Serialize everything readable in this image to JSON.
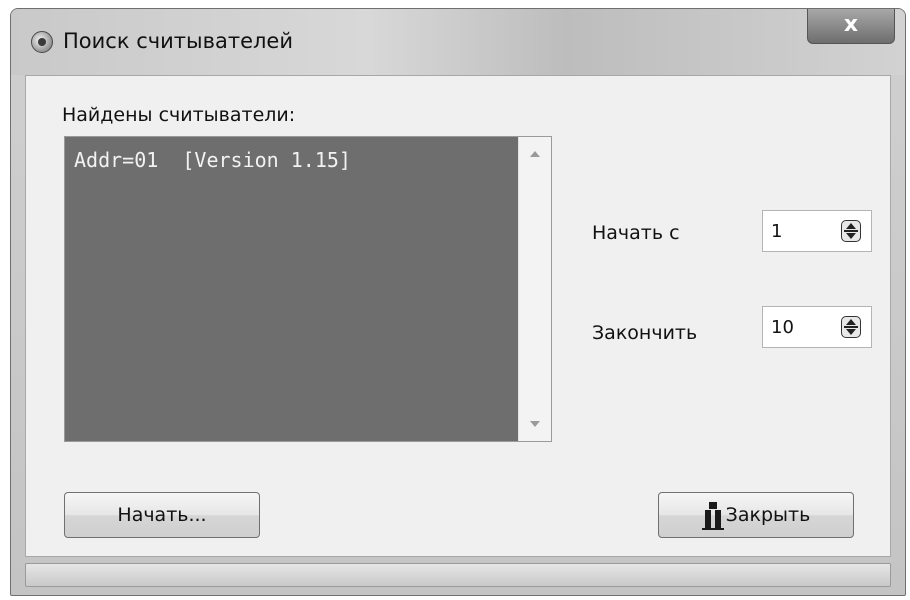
{
  "window": {
    "title": "Поиск считывателей",
    "close_glyph": "x",
    "title_icon": "app-icon"
  },
  "readers": {
    "label": "Найдены считыватели:",
    "items": [
      "Addr=01  [Version 1.15]"
    ]
  },
  "range": {
    "start_label": "Начать с",
    "start_value": "1",
    "end_label": "Закончить",
    "end_value": "10"
  },
  "buttons": {
    "start_label": "Начать...",
    "close_label": "Закрыть",
    "close_icon": "exit-icon"
  },
  "colors": {
    "list_background": "#6e6e6e",
    "list_text": "#f2f2f2"
  }
}
